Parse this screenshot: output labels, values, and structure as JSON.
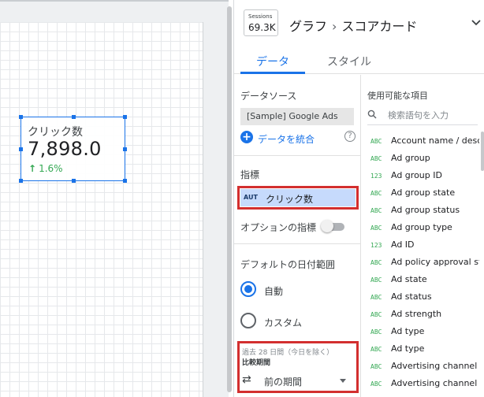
{
  "scorecard": {
    "label": "クリック数",
    "value": "7,898.0",
    "delta": "1.6%",
    "delta_color": "#34a853"
  },
  "panel": {
    "sessions_label": "Sessions",
    "sessions_value": "69.3K",
    "title_part1": "グラフ",
    "title_sep": "›",
    "title_part2": "スコアカード",
    "collapse_icon": "chevron-down-icon"
  },
  "tabs": [
    {
      "label": "データ",
      "active": true
    },
    {
      "label": "スタイル",
      "active": false
    }
  ],
  "data_source": {
    "label": "データソース",
    "name": "[Sample] Google Ads",
    "blend_label": "データを統合",
    "help_glyph": "?"
  },
  "metric": {
    "label": "指標",
    "type_badge": "AUT",
    "name": "クリック数"
  },
  "optional_metric": {
    "label": "オプションの指標",
    "enabled": false
  },
  "date_range": {
    "label": "デフォルトの日付範囲",
    "options": [
      "自動",
      "カスタム"
    ],
    "selected": "自動",
    "period_note": "過去 28 日間（今日を除く）",
    "compare_label": "比較期間",
    "compare_value": "前の期間"
  },
  "fields": {
    "label": "使用可能な項目",
    "search_placeholder": "検索語句を入力",
    "items": [
      {
        "type": "ABC",
        "name": "Account name / descr…"
      },
      {
        "type": "ABC",
        "name": "Ad group"
      },
      {
        "type": "123",
        "name": "Ad group ID"
      },
      {
        "type": "ABC",
        "name": "Ad group state"
      },
      {
        "type": "ABC",
        "name": "Ad group status"
      },
      {
        "type": "ABC",
        "name": "Ad group type"
      },
      {
        "type": "123",
        "name": "Ad ID"
      },
      {
        "type": "ABC",
        "name": "Ad policy approval sta…"
      },
      {
        "type": "ABC",
        "name": "Ad state"
      },
      {
        "type": "ABC",
        "name": "Ad status"
      },
      {
        "type": "ABC",
        "name": "Ad strength"
      },
      {
        "type": "ABC",
        "name": "Ad type"
      },
      {
        "type": "ABC",
        "name": "Ad type"
      },
      {
        "type": "ABC",
        "name": "Advertising channel s…"
      },
      {
        "type": "ABC",
        "name": "Advertising channel ty…"
      }
    ]
  },
  "colors": {
    "accent": "#1a73e8",
    "highlight_box": "#d32f2f",
    "metric_chip": "#c6dafc"
  }
}
